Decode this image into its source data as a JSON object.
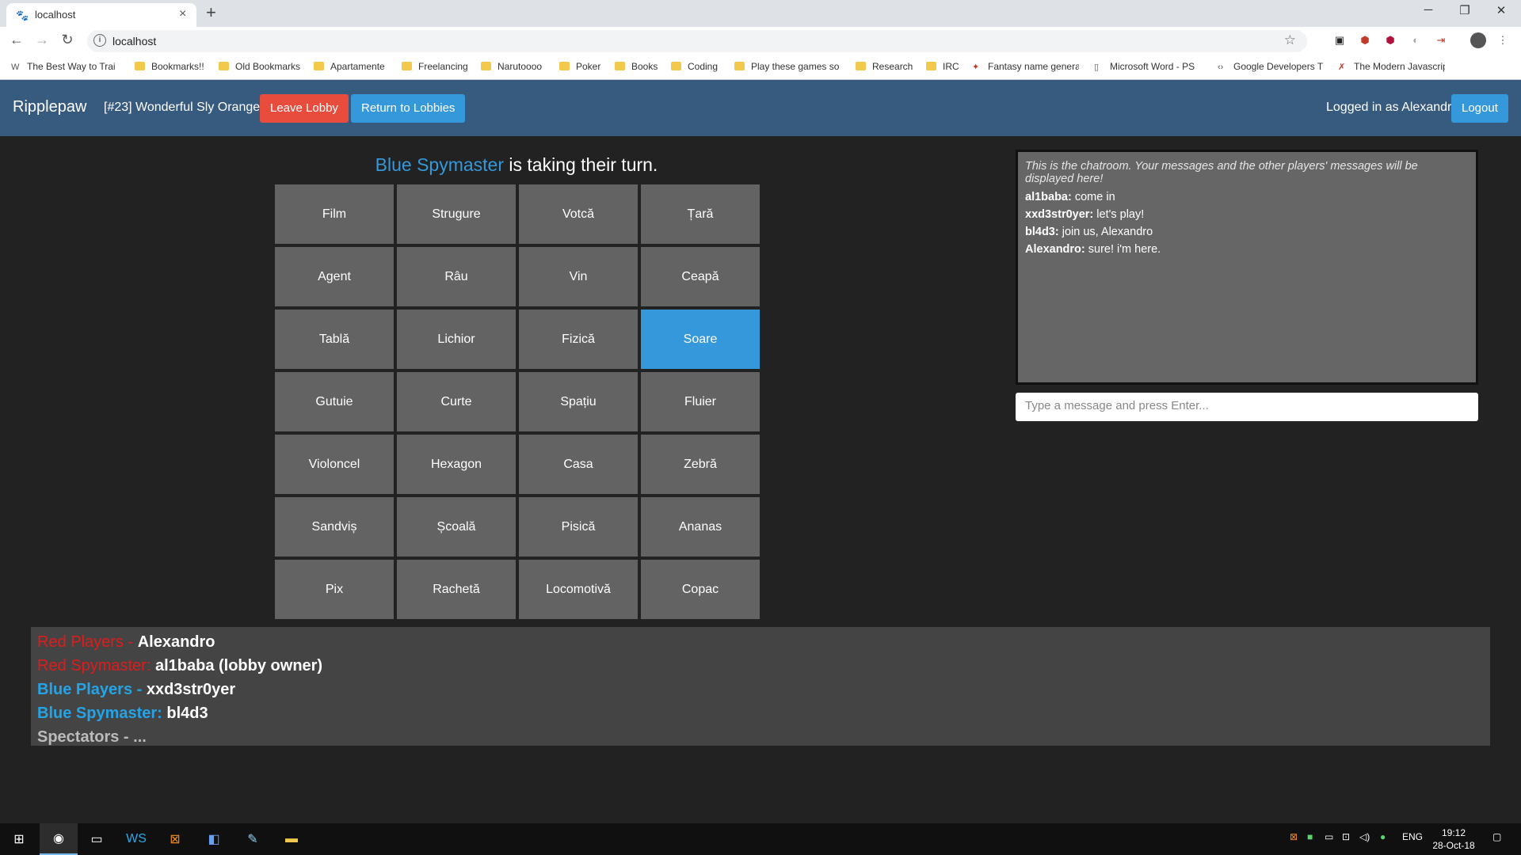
{
  "browser": {
    "tab_title": "localhost",
    "url": "localhost",
    "bookmarks": [
      {
        "label": "The Best Way to Trai",
        "icon": "w"
      },
      {
        "label": "Bookmarks!!",
        "icon": "folder"
      },
      {
        "label": "Old Bookmarks",
        "icon": "folder"
      },
      {
        "label": "Apartamente",
        "icon": "folder"
      },
      {
        "label": "Freelancing",
        "icon": "folder"
      },
      {
        "label": "Narutoooo",
        "icon": "folder"
      },
      {
        "label": "Poker",
        "icon": "folder"
      },
      {
        "label": "Books",
        "icon": "folder"
      },
      {
        "label": "Coding",
        "icon": "folder"
      },
      {
        "label": "Play these games so",
        "icon": "folder"
      },
      {
        "label": "Research",
        "icon": "folder"
      },
      {
        "label": "IRC",
        "icon": "folder"
      },
      {
        "label": "Fantasy name genera",
        "icon": "page"
      },
      {
        "label": "Microsoft Word - PS",
        "icon": "doc"
      },
      {
        "label": "Google Developers T",
        "icon": "code"
      },
      {
        "label": "The Modern Javascrip",
        "icon": "figure"
      }
    ]
  },
  "navbar": {
    "brand": "Ripplepaw",
    "lobby": "[#23] Wonderful Sly Orange",
    "leave_label": "Leave Lobby",
    "return_label": "Return to Lobbies",
    "logged_in": "Logged in as Alexandro",
    "logout_label": "Logout"
  },
  "game": {
    "turn_team": "Blue Spymaster",
    "turn_text": " is taking their turn.",
    "cards": [
      "Film",
      "Strugure",
      "Votcă",
      "Țară",
      "Agent",
      "Râu",
      "Vin",
      "Ceapă",
      "Tablă",
      "Lichior",
      "Fizică",
      "Soare",
      "Gutuie",
      "Curte",
      "Spațiu",
      "Fluier",
      "Violoncel",
      "Hexagon",
      "Casa",
      "Zebră",
      "Sandviș",
      "Școală",
      "Pisică",
      "Ananas",
      "Pix",
      "Rachetă",
      "Locomotivă",
      "Copac"
    ],
    "selected_card": "Soare"
  },
  "chat": {
    "intro": "This is the chatroom. Your messages and the other players' messages will be displayed here!",
    "messages": [
      {
        "user": "al1baba:",
        "text": " come in"
      },
      {
        "user": "xxd3str0yer:",
        "text": " let's play!"
      },
      {
        "user": "bl4d3:",
        "text": " join us, Alexandro"
      },
      {
        "user": "Alexandro:",
        "text": " sure! i'm here."
      }
    ],
    "placeholder": "Type a message and press Enter..."
  },
  "teams": {
    "red_players_label": "Red Players - ",
    "red_players": "Alexandro",
    "red_spymaster_label": "Red Spymaster: ",
    "red_spymaster": "al1baba (lobby owner)",
    "blue_players_label": "Blue Players - ",
    "blue_players": "xxd3str0yer",
    "blue_spymaster_label": "Blue Spymaster: ",
    "blue_spymaster": "bl4d3",
    "spectators": "Spectators - ..."
  },
  "taskbar": {
    "language": "ENG",
    "time": "19:12",
    "date": "28-Oct-18"
  },
  "colors": {
    "navbar": "#375a7f",
    "danger": "#e74c3c",
    "info": "#3498db",
    "card": "#636363",
    "card_selected": "#3498db",
    "red_team": "#e11b1b",
    "blue_team": "#24a4e6"
  }
}
